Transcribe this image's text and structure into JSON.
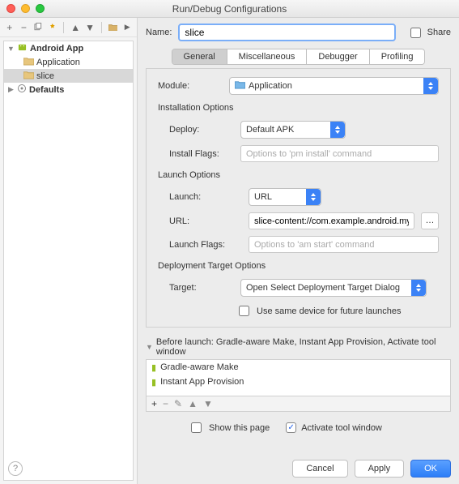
{
  "window": {
    "title": "Run/Debug Configurations"
  },
  "name_row": {
    "label": "Name:",
    "value": "slice",
    "share_label": "Share"
  },
  "tree": {
    "root1": "Android App",
    "child1": "Application",
    "child2": "slice",
    "root2": "Defaults"
  },
  "tabs": {
    "general": "General",
    "misc": "Miscellaneous",
    "debugger": "Debugger",
    "profiling": "Profiling"
  },
  "module": {
    "label": "Module:",
    "value": "Application"
  },
  "install": {
    "section": "Installation Options",
    "deploy_label": "Deploy:",
    "deploy_value": "Default APK",
    "flags_label": "Install Flags:",
    "flags_placeholder": "Options to 'pm install' command"
  },
  "launch": {
    "section": "Launch Options",
    "launch_label": "Launch:",
    "launch_value": "URL",
    "url_label": "URL:",
    "url_value": "slice-content://com.example.android.myslice/path",
    "flags_label": "Launch Flags:",
    "flags_placeholder": "Options to 'am start' command"
  },
  "deploy_target": {
    "section": "Deployment Target Options",
    "target_label": "Target:",
    "target_value": "Open Select Deployment Target Dialog",
    "same_device": "Use same device for future launches"
  },
  "before": {
    "title": "Before launch: Gradle-aware Make, Instant App Provision, Activate tool window",
    "item1": "Gradle-aware Make",
    "item2": "Instant App Provision"
  },
  "bottom": {
    "show": "Show this page",
    "activate": "Activate tool window"
  },
  "buttons": {
    "cancel": "Cancel",
    "apply": "Apply",
    "ok": "OK"
  }
}
